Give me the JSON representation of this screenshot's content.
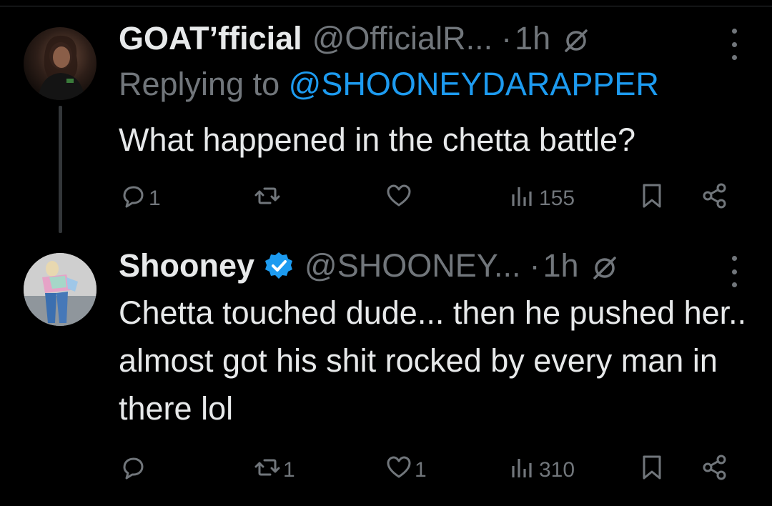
{
  "colors": {
    "background": "#000000",
    "text": "#e7e9ea",
    "muted": "#71767b",
    "link": "#1d9bf0",
    "verified": "#1d9bf0"
  },
  "tweets": [
    {
      "name": "GOAT’fficial",
      "handle": "@OfficialR...",
      "dot": "·",
      "time": "1h",
      "replying_prefix": "Replying to ",
      "replying_to": "@SHOONEYDARAPPER",
      "body": "What happened in the chetta battle?",
      "actions": {
        "replies": "1",
        "reposts": "",
        "likes": "",
        "views": "155"
      },
      "icons": [
        "reply-icon",
        "repost-icon",
        "like-icon",
        "views-icon",
        "bookmark-icon",
        "share-icon",
        "grok-icon",
        "more-icon"
      ]
    },
    {
      "name": "Shooney",
      "handle": "@SHOONEY...",
      "dot": "·",
      "time": "1h",
      "verified": true,
      "body": "Chetta touched dude... then he pushed her.. almost got his shit rocked by every man in there lol",
      "actions": {
        "replies": "",
        "reposts": "1",
        "likes": "1",
        "views": "310"
      },
      "icons": [
        "reply-icon",
        "repost-icon",
        "like-icon",
        "views-icon",
        "bookmark-icon",
        "share-icon",
        "verified-icon",
        "grok-icon",
        "more-icon"
      ]
    }
  ]
}
